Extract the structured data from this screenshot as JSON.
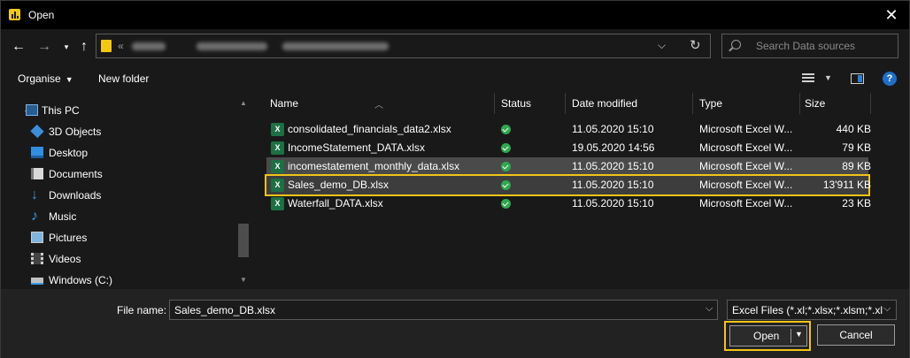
{
  "window": {
    "title": "Open",
    "close_glyph": "✕"
  },
  "address": {
    "overflow": "«",
    "refresh_glyph": "↻",
    "chevron_glyph": "⌵"
  },
  "search": {
    "placeholder": "Search Data sources"
  },
  "toolbar": {
    "organise": "Organise",
    "new_folder": "New folder"
  },
  "nav": {
    "items": [
      {
        "label": "This PC",
        "icon": "computer-icon"
      },
      {
        "label": "3D Objects",
        "icon": "cube-icon"
      },
      {
        "label": "Desktop",
        "icon": "desktop-icon"
      },
      {
        "label": "Documents",
        "icon": "document-icon"
      },
      {
        "label": "Downloads",
        "icon": "download-icon"
      },
      {
        "label": "Music",
        "icon": "music-icon"
      },
      {
        "label": "Pictures",
        "icon": "picture-icon"
      },
      {
        "label": "Videos",
        "icon": "video-icon"
      },
      {
        "label": "Windows (C:)",
        "icon": "drive-icon"
      }
    ]
  },
  "list": {
    "columns": {
      "name": "Name",
      "status": "Status",
      "date": "Date modified",
      "type": "Type",
      "size": "Size"
    },
    "files": [
      {
        "name": "consolidated_financials_data2.xlsx",
        "date": "11.05.2020 15:10",
        "type": "Microsoft Excel W...",
        "size": "440 KB"
      },
      {
        "name": "IncomeStatement_DATA.xlsx",
        "date": "19.05.2020 14:56",
        "type": "Microsoft Excel W...",
        "size": "79 KB"
      },
      {
        "name": "incomestatement_monthly_data.xlsx",
        "date": "11.05.2020 15:10",
        "type": "Microsoft Excel W...",
        "size": "89 KB"
      },
      {
        "name": "Sales_demo_DB.xlsx",
        "date": "11.05.2020 15:10",
        "type": "Microsoft Excel W...",
        "size": "13'911 KB"
      },
      {
        "name": "Waterfall_DATA.xlsx",
        "date": "11.05.2020 15:10",
        "type": "Microsoft Excel W...",
        "size": "23 KB"
      }
    ],
    "selected_index": 3,
    "hover_index": 2
  },
  "footer": {
    "file_name_label": "File name:",
    "file_name_value": "Sales_demo_DB.xlsx",
    "filter_value": "Excel Files (*.xl;*.xlsx;*.xlsm;*.xl",
    "open_label": "Open",
    "cancel_label": "Cancel"
  },
  "colors": {
    "highlight": "#f0c419",
    "accent": "#f2c811",
    "excel": "#1d7044",
    "status_ok": "#2fa84f"
  }
}
